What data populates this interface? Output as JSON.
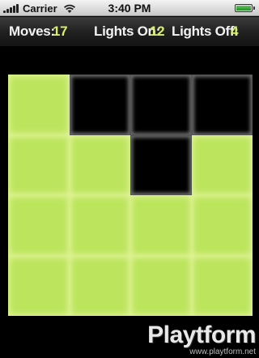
{
  "status_bar": {
    "carrier": "Carrier",
    "time": "3:40 PM",
    "battery_level": 1.0
  },
  "game": {
    "moves_label": "Moves:",
    "moves": "17",
    "lights_on_label": "Lights On:",
    "lights_on": "12",
    "lights_off_label": "Lights Off:",
    "lights_off": "4",
    "colors": {
      "light_on": "#bce55d",
      "light_off": "#000000",
      "value_text": "#d6f06a"
    },
    "board": [
      [
        "on",
        "off",
        "off",
        "off"
      ],
      [
        "on",
        "on",
        "off",
        "on"
      ],
      [
        "on",
        "on",
        "on",
        "on"
      ],
      [
        "on",
        "on",
        "on",
        "on"
      ]
    ]
  },
  "watermark": {
    "logo": "Playtform",
    "url": "www.playtform.net"
  }
}
